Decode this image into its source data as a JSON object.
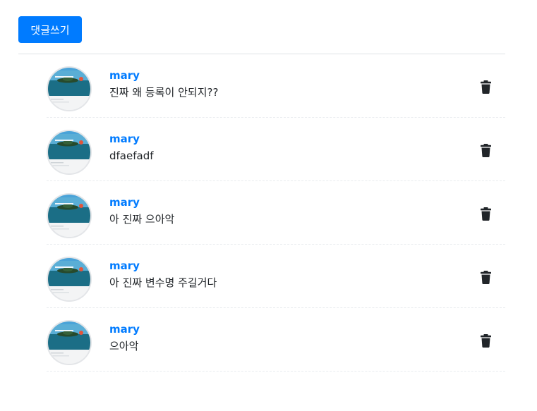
{
  "toolbar": {
    "write_comment_label": "댓글쓰기"
  },
  "comments": [
    {
      "author": "mary",
      "content": "진짜 왜 등록이 안되지??",
      "avatar_icon": "island-photo-avatar",
      "delete_icon": "trash-icon"
    },
    {
      "author": "mary",
      "content": "dfaefadf",
      "avatar_icon": "island-photo-avatar",
      "delete_icon": "trash-icon"
    },
    {
      "author": "mary",
      "content": "아 진짜 으아악",
      "avatar_icon": "island-photo-avatar",
      "delete_icon": "trash-icon"
    },
    {
      "author": "mary",
      "content": "아 진짜 변수명 주길거다",
      "avatar_icon": "island-photo-avatar",
      "delete_icon": "trash-icon"
    },
    {
      "author": "mary",
      "content": "으아악",
      "avatar_icon": "island-photo-avatar",
      "delete_icon": "trash-icon"
    }
  ],
  "colors": {
    "accent": "#007bff",
    "text": "#212529",
    "icon": "#212529"
  }
}
